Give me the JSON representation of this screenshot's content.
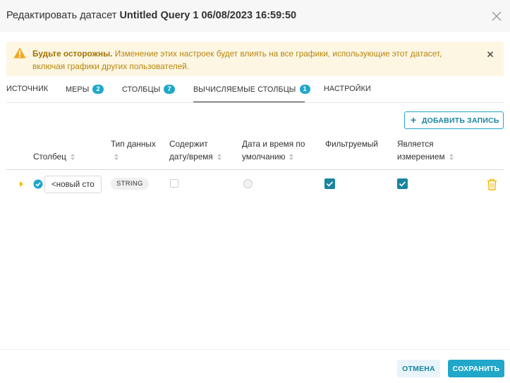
{
  "modal": {
    "title_prefix": "Редактировать датасет",
    "title_name": "Untitled Query 1 06/08/2023 16:59:50",
    "close_icon": "close-icon"
  },
  "warning": {
    "icon": "warning-triangle-icon",
    "bold": "Будьте осторожны.",
    "text": "Изменение этих настроек будет влиять на все графики, использующие этот датасет, включая графики других пользователей."
  },
  "tabs": [
    {
      "label": "ИСТОЧНИК"
    },
    {
      "label": "МЕРЫ",
      "badge": "2"
    },
    {
      "label": "СТОЛБЦЫ",
      "badge": "7"
    },
    {
      "label": "ВЫЧИСЛЯЕМЫЕ СТОЛБЦЫ",
      "badge": "1",
      "active": true
    },
    {
      "label": "НАСТРОЙКИ"
    }
  ],
  "add_record_button": "ДОБАВИТЬ ЗАПИСЬ",
  "columns": {
    "column": "Столбец",
    "data_type": "Тип данных",
    "contains_date_line1": "Содержит",
    "contains_date_line2": "дату/время",
    "default_datetime_line1": "Дата и время по",
    "default_datetime_line2": "умолчанию",
    "filterable": "Фильтруемый",
    "is_dimension_line1": "Является",
    "is_dimension_line2": "измерением"
  },
  "rows": [
    {
      "name_value": "<новый сто",
      "data_type": "STRING",
      "contains_date": false,
      "default_datetime": false,
      "filterable": true,
      "is_dimension": true
    }
  ],
  "footer": {
    "cancel": "ОТМЕНА",
    "save": "СОХРАНИТЬ"
  },
  "colors": {
    "accent": "#20a7c9",
    "accent_dark": "#1985a0",
    "warning_bg": "#fcf6e3",
    "warning_icon": "#f5a623",
    "trash": "#f5b800"
  }
}
